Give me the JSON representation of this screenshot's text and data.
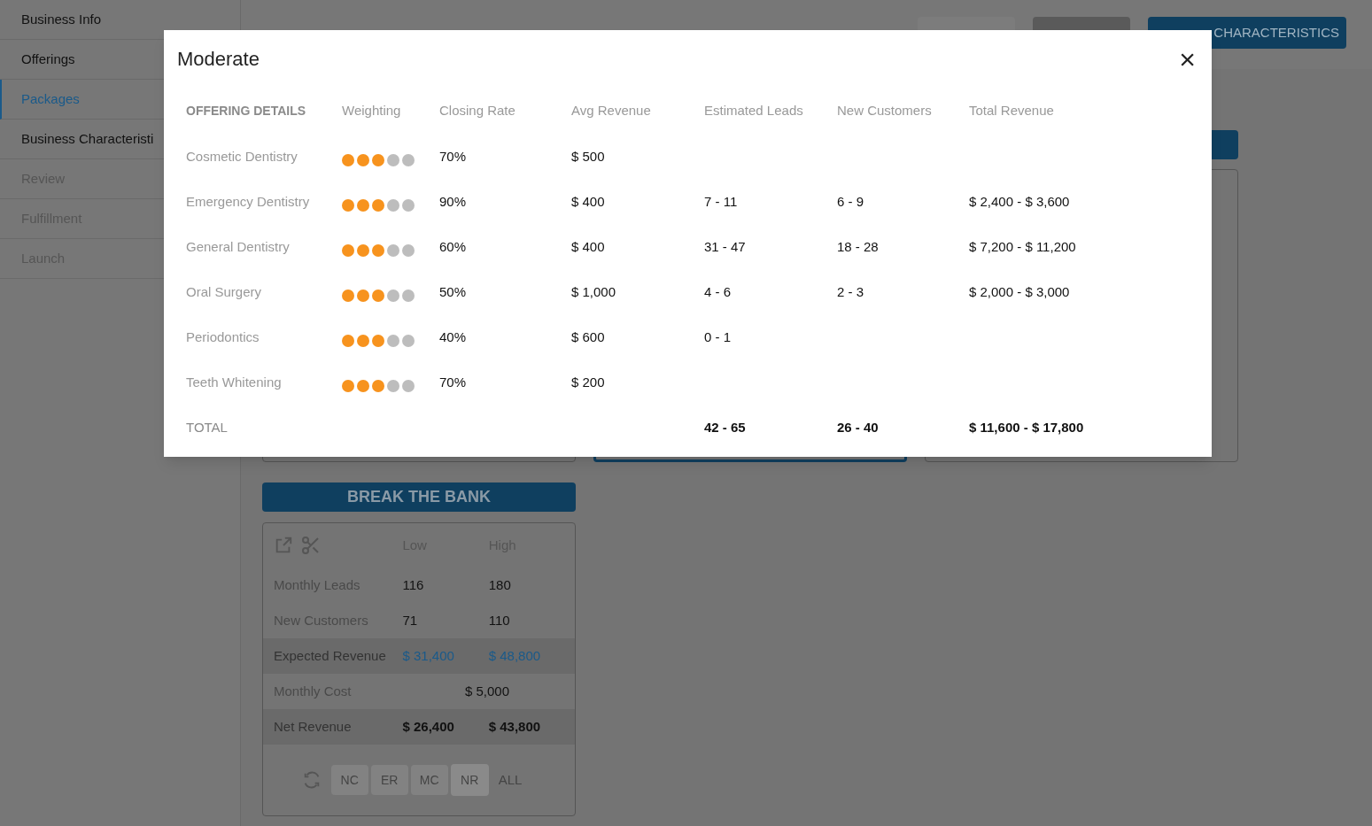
{
  "sidebar": {
    "items": [
      {
        "label": "Business Info",
        "selected": false,
        "enabled": true
      },
      {
        "label": "Offerings",
        "selected": false,
        "enabled": true
      },
      {
        "label": "Packages",
        "selected": true,
        "enabled": true
      },
      {
        "label": "Business Characteristi",
        "selected": false,
        "enabled": true
      },
      {
        "label": "Review",
        "selected": false,
        "enabled": false
      },
      {
        "label": "Fulfillment",
        "selected": false,
        "enabled": false
      },
      {
        "label": "Launch",
        "selected": false,
        "enabled": false
      }
    ]
  },
  "header": {
    "buttons": [
      {
        "kind": "light"
      },
      {
        "kind": "dark"
      },
      {
        "label": "CHARACTERISTICS",
        "kind": "primary"
      }
    ]
  },
  "package": {
    "title": "BREAK THE BANK",
    "columns": [
      "Low",
      "High"
    ],
    "rows": [
      {
        "label": "Monthly Leads",
        "kind": "plain",
        "low": "116",
        "high": "180"
      },
      {
        "label": "New Customers",
        "kind": "plain",
        "low": "71",
        "high": "110"
      },
      {
        "label": "Expected Revenue",
        "kind": "highlight",
        "low": "$ 31,400",
        "high": "$ 48,800"
      },
      {
        "label": "Monthly Cost",
        "kind": "span",
        "value": "$ 5,000"
      },
      {
        "label": "Net Revenue",
        "kind": "total",
        "low": "$ 26,400",
        "high": "$ 43,800"
      }
    ],
    "filters": [
      {
        "label": "NC",
        "selected": false
      },
      {
        "label": "ER",
        "selected": false
      },
      {
        "label": "MC",
        "selected": false
      },
      {
        "label": "NR",
        "selected": true
      }
    ],
    "all_label": "ALL"
  },
  "modal": {
    "title": "Moderate",
    "close": "×",
    "columns": [
      "OFFERING DETAILS",
      "Weighting",
      "Closing Rate",
      "Avg Revenue",
      "Estimated Leads",
      "New Customers",
      "Total Revenue"
    ],
    "rows": [
      {
        "name": "Cosmetic Dentistry",
        "stars": 3,
        "closing_rate": "70%",
        "avg_revenue": "$ 500"
      },
      {
        "name": "Emergency Dentistry",
        "stars": 3,
        "closing_rate": "90%",
        "avg_revenue": "$ 400",
        "leads": "7 - 11",
        "customers": "6 - 9",
        "revenue": "$ 2,400 - $ 3,600"
      },
      {
        "name": "General Dentistry",
        "stars": 3,
        "closing_rate": "60%",
        "avg_revenue": "$ 400",
        "leads": "31 - 47",
        "customers": "18 - 28",
        "revenue": "$ 7,200 - $ 11,200"
      },
      {
        "name": "Oral Surgery",
        "stars": 3,
        "closing_rate": "50%",
        "avg_revenue": "$ 1,000",
        "leads": "4 - 6",
        "customers": "2 - 3",
        "revenue": "$ 2,000 - $ 3,000"
      },
      {
        "name": "Periodontics",
        "stars": 3,
        "closing_rate": "40%",
        "avg_revenue": "$ 600",
        "leads": "0 - 1"
      },
      {
        "name": "Teeth Whitening",
        "stars": 3,
        "closing_rate": "70%",
        "avg_revenue": "$ 200"
      }
    ],
    "total": {
      "label": "TOTAL",
      "leads": "42 - 65",
      "customers": "26 - 40",
      "revenue": "$ 11,600 - $ 17,800"
    }
  }
}
